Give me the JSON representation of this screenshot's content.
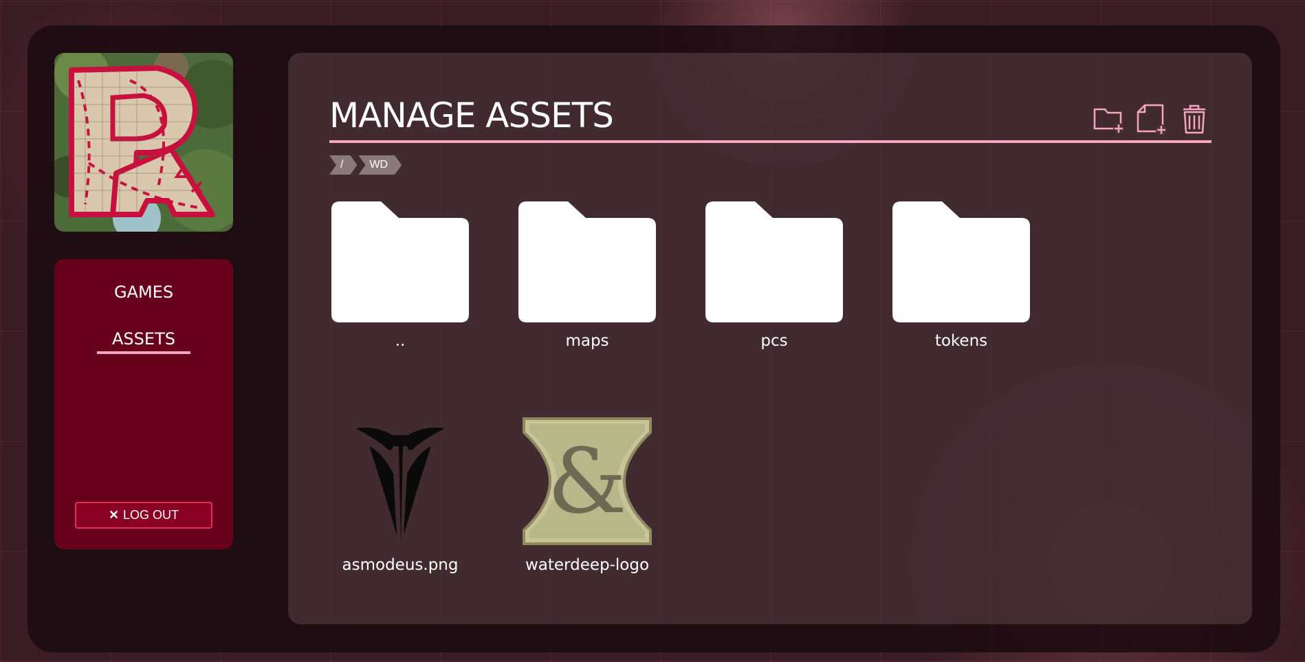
{
  "header": {
    "title": "MANAGE ASSETS"
  },
  "toolbar": [
    "new-folder-icon",
    "new-file-icon",
    "trash-icon"
  ],
  "breadcrumb": [
    "/",
    "WD"
  ],
  "sidebar": {
    "items": [
      {
        "label": "GAMES",
        "active": false
      },
      {
        "label": "ASSETS",
        "active": true
      }
    ],
    "logout_label": "LOG OUT"
  },
  "folders": [
    {
      "name": ".."
    },
    {
      "name": "maps"
    },
    {
      "name": "pcs"
    },
    {
      "name": "tokens"
    }
  ],
  "files": [
    {
      "name": "asmodeus.png",
      "icon": "asmodeus-icon"
    },
    {
      "name": "waterdeep-logo",
      "icon": "dnd-ampersand-icon"
    }
  ],
  "colors": {
    "accent_pink": "#f6a6c0",
    "sidebar_crimson": "#73001e",
    "logout_button": "#8a0024",
    "panel": "#5f464b"
  }
}
